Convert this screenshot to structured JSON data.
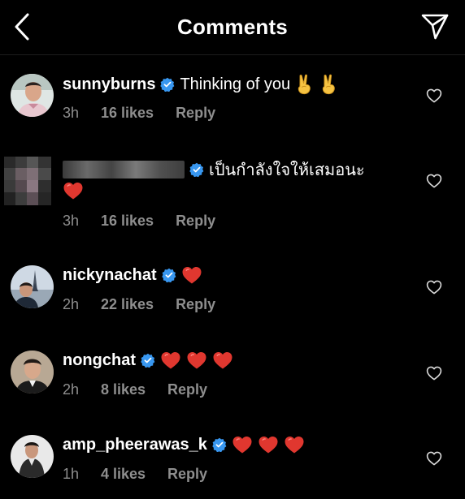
{
  "header": {
    "title": "Comments",
    "back_icon": "chevron-left-icon",
    "share_icon": "paper-plane-icon"
  },
  "colors": {
    "background": "#000000",
    "text": "#ffffff",
    "muted": "#8e8e8e",
    "verified": "#3897f0",
    "heart": "#e0372f"
  },
  "comments": [
    {
      "username": "sunnyburns",
      "verified": true,
      "text": "Thinking of you",
      "emoji": [
        "victory-hand-icon",
        "victory-hand-icon"
      ],
      "time": "3h",
      "likes": "16 likes",
      "reply": "Reply"
    },
    {
      "username": "",
      "username_obscured": true,
      "verified": true,
      "text": "เป็นกำลังใจให้เสมอนะ",
      "emoji": [
        "red-heart-icon"
      ],
      "time": "3h",
      "likes": "16 likes",
      "reply": "Reply"
    },
    {
      "username": "nickynachat",
      "verified": true,
      "text": "",
      "emoji": [
        "red-heart-icon"
      ],
      "time": "2h",
      "likes": "22 likes",
      "reply": "Reply"
    },
    {
      "username": "nongchat",
      "verified": true,
      "text": "",
      "emoji": [
        "red-heart-icon",
        "red-heart-icon",
        "red-heart-icon"
      ],
      "time": "2h",
      "likes": "8 likes",
      "reply": "Reply"
    },
    {
      "username": "amp_pheerawas_k",
      "verified": true,
      "text": "",
      "emoji": [
        "red-heart-icon",
        "red-heart-icon",
        "red-heart-icon"
      ],
      "time": "1h",
      "likes": "4 likes",
      "reply": "Reply"
    }
  ]
}
